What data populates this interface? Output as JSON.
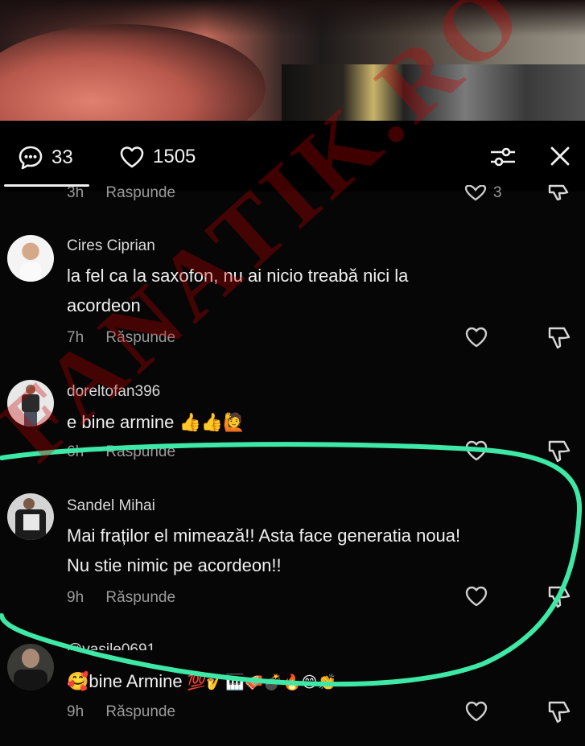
{
  "header": {
    "comments_count": "33",
    "likes_count": "1505"
  },
  "partial_top": {
    "time": "3h",
    "reply_label": "Raspunde",
    "like_count": "3"
  },
  "comments": [
    {
      "username": "Cires Ciprian",
      "text_line1": "la fel ca la saxofon, nu ai nicio treabă nici la",
      "text_line2": "acordeon",
      "time": "7h",
      "reply_label": "Răspunde"
    },
    {
      "username": "doreltofan396",
      "text": "e bine armine",
      "emojis": "👍👍🙋",
      "time": "6h",
      "reply_label": "Raspunde"
    },
    {
      "username": "Sandel Mihai",
      "text_line1": "Mai fraților el mimează!! Asta face generatia noua!",
      "text_line2": "Nu stie nimic pe acordeon!!",
      "time": "9h",
      "reply_label": "Răspunde"
    },
    {
      "username": "@vasile0691",
      "text_prefix": "🥰",
      "text": "bine Armine",
      "emojis": "💯🎷🎹🪗💣🔥😊👏",
      "time": "9h",
      "reply_label": "Răspunde"
    }
  ],
  "watermark": "FANATIK.RO",
  "colors": {
    "background": "#060606",
    "highlight_circle": "#3ee8a6",
    "watermark": "#c80000"
  }
}
